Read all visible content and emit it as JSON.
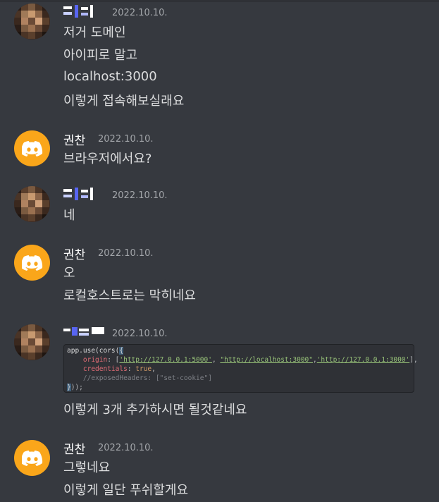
{
  "messages": [
    {
      "author": "",
      "author_masked": true,
      "avatar": "pixelated-avatar",
      "timestamp": "2022.10.10.",
      "lines": [
        "저거 도메인",
        "아이피로 말고",
        "localhost:3000",
        "이렇게 접속해보실래요"
      ]
    },
    {
      "author": "권찬",
      "avatar": "discord-icon",
      "timestamp": "2022.10.10.",
      "lines": [
        "브라우저에서요?"
      ]
    },
    {
      "author": "",
      "author_masked": true,
      "avatar": "pixelated-avatar",
      "timestamp": "2022.10.10.",
      "lines": [
        "네"
      ]
    },
    {
      "author": "권찬",
      "avatar": "discord-icon",
      "timestamp": "2022.10.10.",
      "lines": [
        "오",
        "로컬호스트로는 막히네요"
      ]
    },
    {
      "author": "",
      "author_masked": true,
      "avatar": "pixelated-avatar",
      "timestamp": "2022.10.10.",
      "code": {
        "line1_fn": "app.use(cors(",
        "line1_brace": "{",
        "line2_key": "origin",
        "line2_rest": ": [",
        "line2_s1": "'http://127.0.0.1:5000'",
        "line2_s2": "\"http://localhost:3000\"",
        "line2_s3": "'http://127.0.0.1:3000'",
        "line2_end": "],",
        "line3_key": "credentials",
        "line3_val": "true",
        "line4_comment": "//exposedHeaders: [\"set-cookie\"]",
        "line5_brace": "}",
        "line5_end": "));"
      },
      "lines": [
        "이렇게 3개 추가하시면 될것같네요"
      ]
    },
    {
      "author": "권찬",
      "avatar": "discord-icon",
      "timestamp": "2022.10.10.",
      "lines": [
        "그렇네요",
        "이렇게 일단 푸쉬할게요"
      ]
    }
  ],
  "colors": {
    "background": "#36393f",
    "discord_avatar": "#faa61a",
    "text": "#dcddde",
    "timestamp": "#a3a6aa"
  }
}
